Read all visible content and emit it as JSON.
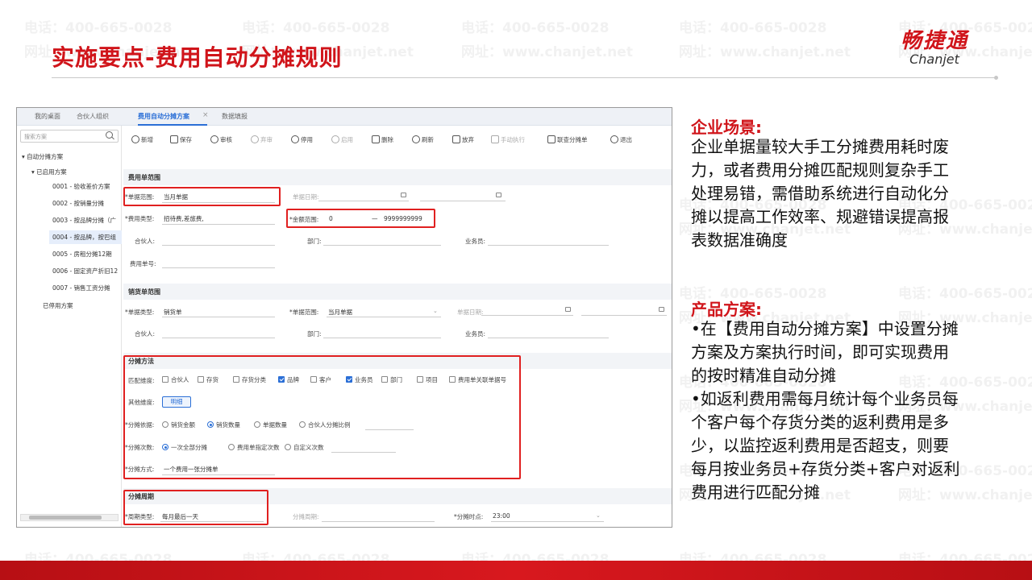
{
  "page": {
    "title": "实施要点-费用自动分摊规则",
    "logo_cn": "畅捷通",
    "logo_en": "Chanjet"
  },
  "watermark": {
    "phone": "电话：400-665-0028",
    "site": "网址：www.chanjet.net"
  },
  "app": {
    "tabs": [
      {
        "label": "我的桌面"
      },
      {
        "label": "合伙人组织"
      },
      {
        "label": "费用自动分摊方案",
        "active": true
      },
      {
        "label": "数据填报"
      }
    ],
    "tab_close": "×",
    "sidebar": {
      "search_placeholder": "搜索方案",
      "tree": [
        {
          "label": "▾  自动分摊方案"
        },
        {
          "label": "▾  已启用方案"
        },
        {
          "label": "0001 - 验收差价方案"
        },
        {
          "label": "0002 - 按销量分摊"
        },
        {
          "label": "0003 - 按品牌分摊（广"
        },
        {
          "label": "0004 - 按品牌，按巴组",
          "selected": true
        },
        {
          "label": "0005 - 房租分摊12期"
        },
        {
          "label": "0006 - 固定资产折旧12"
        },
        {
          "label": "0007 - 销售工资分摊"
        },
        {
          "label": "已停用方案"
        }
      ]
    },
    "toolbar": [
      {
        "label": "新增",
        "icon": "plus-circle-icon"
      },
      {
        "label": "保存",
        "icon": "save-icon"
      },
      {
        "label": "审核",
        "icon": "approve-icon"
      },
      {
        "label": "弃审",
        "icon": "unapprove-icon",
        "disabled": true
      },
      {
        "label": "停用",
        "icon": "power-icon"
      },
      {
        "label": "启用",
        "icon": "check-circle-icon",
        "disabled": true
      },
      {
        "label": "删除",
        "icon": "trash-icon"
      },
      {
        "label": "刷新",
        "icon": "refresh-icon"
      },
      {
        "label": "放弃",
        "icon": "discard-icon"
      },
      {
        "label": "手动执行",
        "icon": "run-icon",
        "disabled": true
      },
      {
        "label": "联查分摊单",
        "icon": "link-doc-icon"
      },
      {
        "label": "退出",
        "icon": "exit-icon"
      }
    ],
    "section_expense": {
      "title": "费用单范围",
      "doc_range_label": "*单据范围:",
      "doc_range_value": "当月单据",
      "doc_date_label": "单据日期:",
      "expense_type_label": "*费用类型:",
      "expense_type_value": "招待费,差旅费,",
      "amount_range_label": "*金额范围:",
      "amount_from": "0",
      "amount_dash": "—",
      "amount_to": "9999999999",
      "partner_label": "合伙人:",
      "dept_label": "部门:",
      "salesman_label": "业务员:",
      "expense_no_label": "费用单号:"
    },
    "section_sales": {
      "title": "销货单范围",
      "doc_type_label": "*单据类型:",
      "doc_type_value": "销货单",
      "doc_range_label": "*单据范围:",
      "doc_range_value": "当月单据",
      "doc_date_label": "单据日期:",
      "partner_label": "合伙人:",
      "dept_label": "部门:",
      "salesman_label": "业务员:"
    },
    "section_method": {
      "title": "分摊方法",
      "match_label": "匹配维度:",
      "match_options": [
        {
          "label": "合伙人",
          "checked": false
        },
        {
          "label": "存货",
          "checked": false
        },
        {
          "label": "存货分类",
          "checked": false
        },
        {
          "label": "品牌",
          "checked": true
        },
        {
          "label": "客户",
          "checked": false
        },
        {
          "label": "业务员",
          "checked": true
        },
        {
          "label": "部门",
          "checked": false
        },
        {
          "label": "项目",
          "checked": false
        },
        {
          "label": "费用单关联单据号",
          "checked": false
        }
      ],
      "other_label": "其他维度:",
      "detail_button": "明细",
      "basis_label": "*分摊依据:",
      "basis_options": [
        {
          "label": "销货金额",
          "selected": false
        },
        {
          "label": "销货数量",
          "selected": true
        },
        {
          "label": "单据数量",
          "selected": false
        },
        {
          "label": "合伙人分摊比例",
          "selected": false
        }
      ],
      "times_label": "*分摊次数:",
      "times_options": [
        {
          "label": "一次全部分摊",
          "selected": true
        },
        {
          "label": "费用单指定次数",
          "selected": false
        },
        {
          "label": "自定义次数",
          "selected": false
        }
      ],
      "mode_label": "*分摊方式:",
      "mode_value": "一个费用一张分摊单"
    },
    "section_period": {
      "title": "分摊周期",
      "cycle_type_label": "*周期类型:",
      "cycle_type_value": "每月最后一天",
      "cycle_label": "分摊周期:",
      "time_label": "*分摊时点:",
      "time_value": "23:00"
    }
  },
  "right": {
    "scene_head": "企业场景:",
    "scene_lines": [
      "企业单据量较大手工分摊费用耗时废",
      "力，或者费用分摊匹配规则复杂手工",
      "处理易错，需借助系统进行自动化分",
      "摊以提高工作效率、规避错误提高报",
      "表数据准确度"
    ],
    "product_head": "产品方案:",
    "product_lines": [
      "•在【费用自动分摊方案】中设置分摊",
      "方案及方案执行时间，即可实现费用",
      "的按时精准自动分摊",
      "•如返利费用需每月统计每个业务员每",
      "个客户每个存货分类的返利费用是多",
      "少，以监控返利费用是否超支，则要",
      "每月按业务员+存货分类+客户对返利",
      "费用进行匹配分摊"
    ]
  },
  "colors": {
    "brand_red": "#d0141a",
    "highlight_red": "#e02020",
    "accent_blue": "#2b6fd6"
  }
}
